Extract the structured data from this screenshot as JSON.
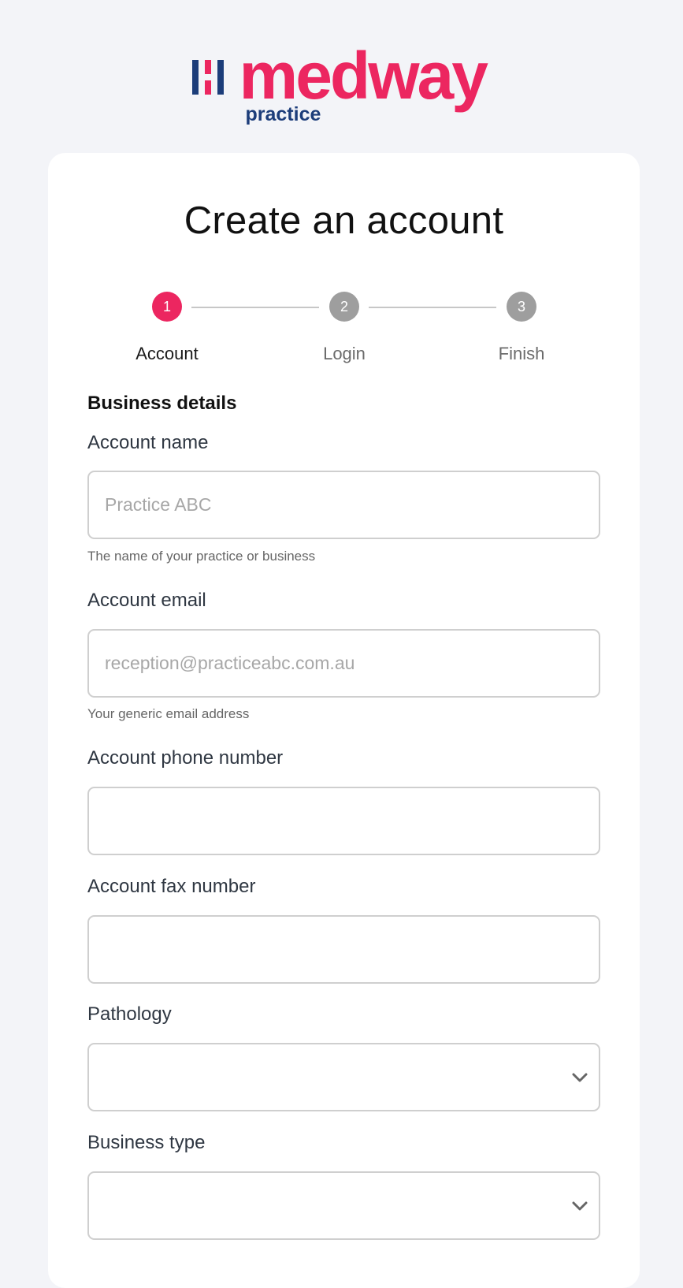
{
  "brand": {
    "name": "medway",
    "sub": "practice",
    "primary_color": "#ec2660",
    "secondary_color": "#1c3d7a"
  },
  "page": {
    "title": "Create an account"
  },
  "stepper": {
    "steps": [
      {
        "number": "1",
        "label": "Account",
        "active": true
      },
      {
        "number": "2",
        "label": "Login",
        "active": false
      },
      {
        "number": "3",
        "label": "Finish",
        "active": false
      }
    ]
  },
  "form": {
    "section_title": "Business details",
    "account_name": {
      "label": "Account name",
      "placeholder": "Practice ABC",
      "value": "",
      "help": "The name of your practice or business"
    },
    "account_email": {
      "label": "Account email",
      "placeholder": "reception@practiceabc.com.au",
      "value": "",
      "help": "Your generic email address"
    },
    "account_phone": {
      "label": "Account phone number",
      "placeholder": "",
      "value": ""
    },
    "account_fax": {
      "label": "Account fax number",
      "placeholder": "",
      "value": ""
    },
    "pathology": {
      "label": "Pathology",
      "selected": "",
      "icon": "chevron-down-icon"
    },
    "business_type": {
      "label": "Business type",
      "selected": "",
      "icon": "chevron-down-icon"
    }
  }
}
